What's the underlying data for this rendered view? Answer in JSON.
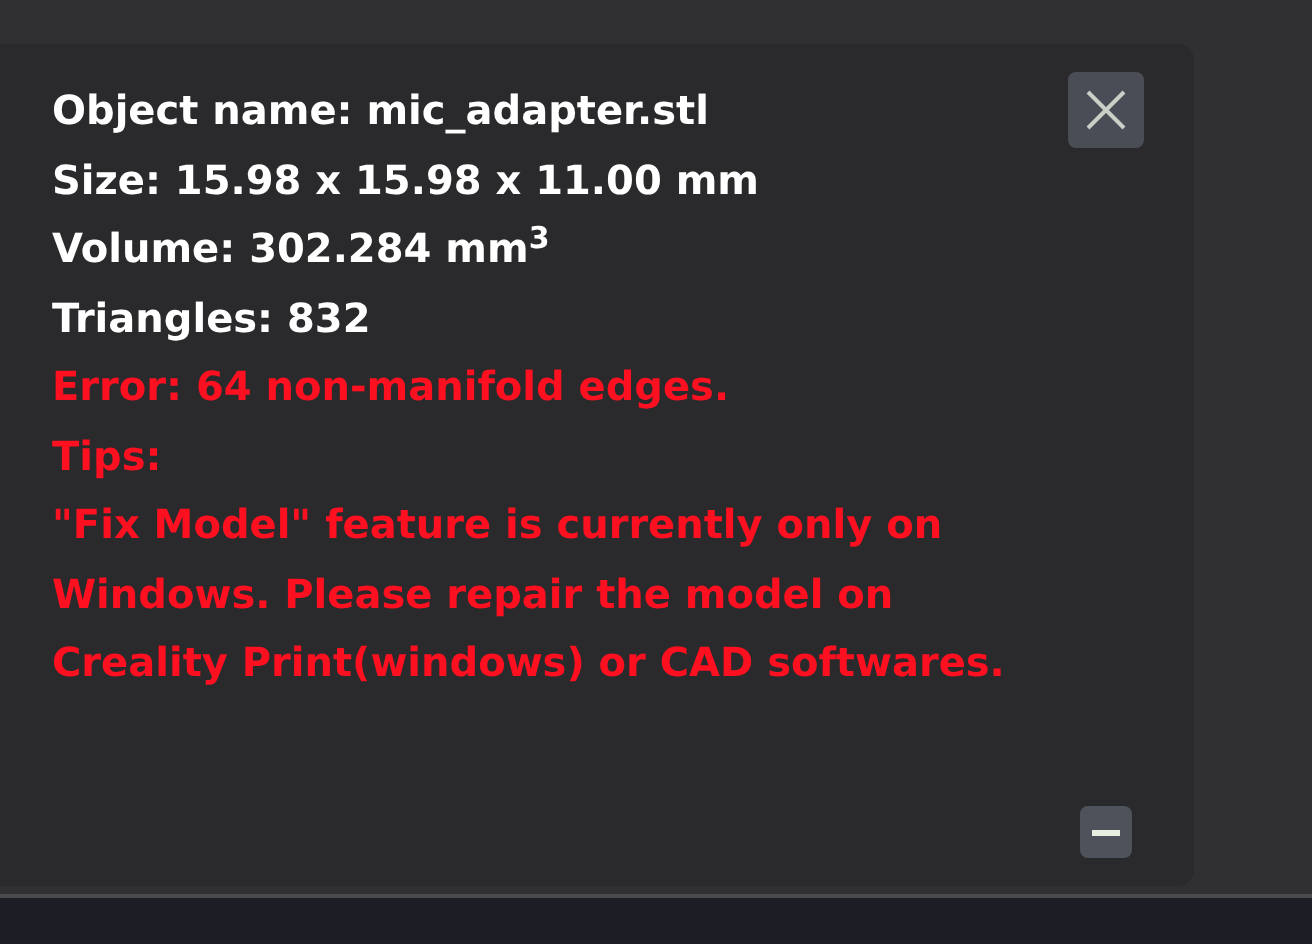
{
  "info_lines": [
    {
      "kind": "info",
      "text": "Object name: mic_adapter.stl"
    },
    {
      "kind": "info",
      "text": "Size: 15.98 x 15.98 x 11.00 mm"
    },
    {
      "kind": "info",
      "text": "Volume: 302.284 mm$^{3}$"
    },
    {
      "kind": "info",
      "text": "Triangles: 832"
    },
    {
      "kind": "error",
      "text": "Error: 64 non-manifold edges."
    },
    {
      "kind": "error",
      "text": "Tips:"
    },
    {
      "kind": "error",
      "text": "\"Fix Model\" feature is currently only on Windows. Please repair the model on Creality Print(windows) or CAD softwares."
    }
  ]
}
